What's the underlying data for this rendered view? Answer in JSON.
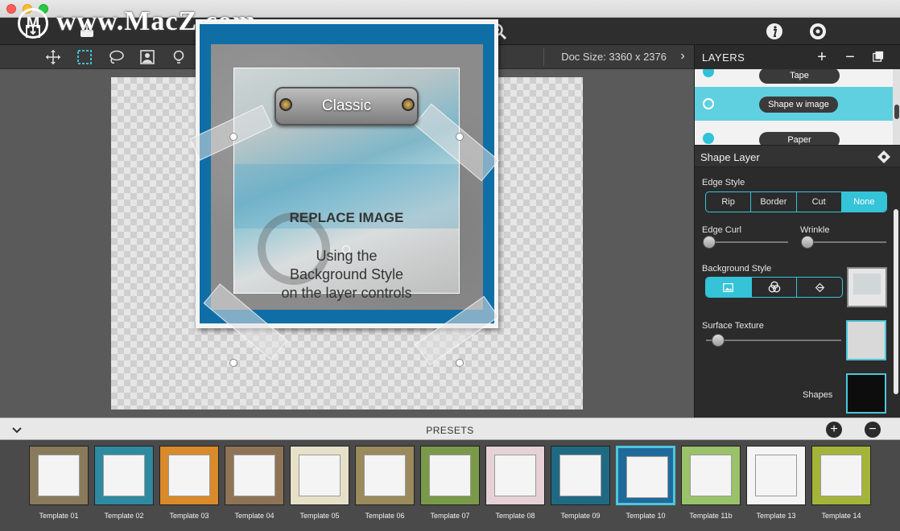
{
  "watermark": {
    "text": "www.MacZ.com",
    "logo_letter": "M"
  },
  "toolbar": {
    "icons": [
      "import-icon",
      "export-icon",
      "zoom-in-icon",
      "undo-icon",
      "redo-icon",
      "zoom-out-icon",
      "info-icon",
      "settings-icon"
    ]
  },
  "subbar": {
    "tools": [
      "move-tool-icon",
      "rect-select-tool-icon",
      "lasso-tool-icon",
      "portrait-tool-icon",
      "light-tool-icon",
      "line-tool-icon",
      "rotate-tool-icon"
    ],
    "doc_size": "Doc Size: 3360 x 2376",
    "chevron": "›"
  },
  "canvas": {
    "plaque": "Classic",
    "placeholder_title": "REPLACE IMAGE",
    "placeholder_lines": [
      "Using the",
      "Background Style",
      "on the layer controls"
    ],
    "close": "×"
  },
  "layers": {
    "title": "LAYERS",
    "add": "+",
    "remove": "−",
    "rows": [
      {
        "label": "Tape"
      },
      {
        "label": "Shape w image"
      },
      {
        "label": "Paper"
      }
    ]
  },
  "shape_layer": {
    "title": "Shape Layer",
    "edge_style_label": "Edge Style",
    "edge_styles": [
      "Rip",
      "Border",
      "Cut",
      "None"
    ],
    "edge_style_selected": "None",
    "edge_curl_label": "Edge Curl",
    "edge_curl_value": 0,
    "wrinkle_label": "Wrinkle",
    "wrinkle_value": 0,
    "background_style_label": "Background Style",
    "surface_texture_label": "Surface Texture",
    "surface_texture_value": 0.07,
    "shapes_label": "Shapes"
  },
  "presets": {
    "title": "PRESETS",
    "add": "+",
    "remove": "−",
    "selected": "Template 10",
    "items": [
      {
        "label": "Template 01",
        "color": "#8a7a5c"
      },
      {
        "label": "Template 02",
        "color": "#2e8aa0"
      },
      {
        "label": "Template 03",
        "color": "#d98a2a"
      },
      {
        "label": "Template 04",
        "color": "#8e7456"
      },
      {
        "label": "Template 05",
        "color": "#e7e0c8"
      },
      {
        "label": "Template 06",
        "color": "#9a8a5c"
      },
      {
        "label": "Template 07",
        "color": "#7a9a4a"
      },
      {
        "label": "Template 08",
        "color": "#e6d2d6"
      },
      {
        "label": "Template 09",
        "color": "#1f6a82"
      },
      {
        "label": "Template 10",
        "color": "#1f6a9a"
      },
      {
        "label": "Template 11b",
        "color": "#9ac26a"
      },
      {
        "label": "Template 13",
        "color": "#f4f4f4"
      },
      {
        "label": "Template 14",
        "color": "#a4b43a"
      }
    ]
  }
}
